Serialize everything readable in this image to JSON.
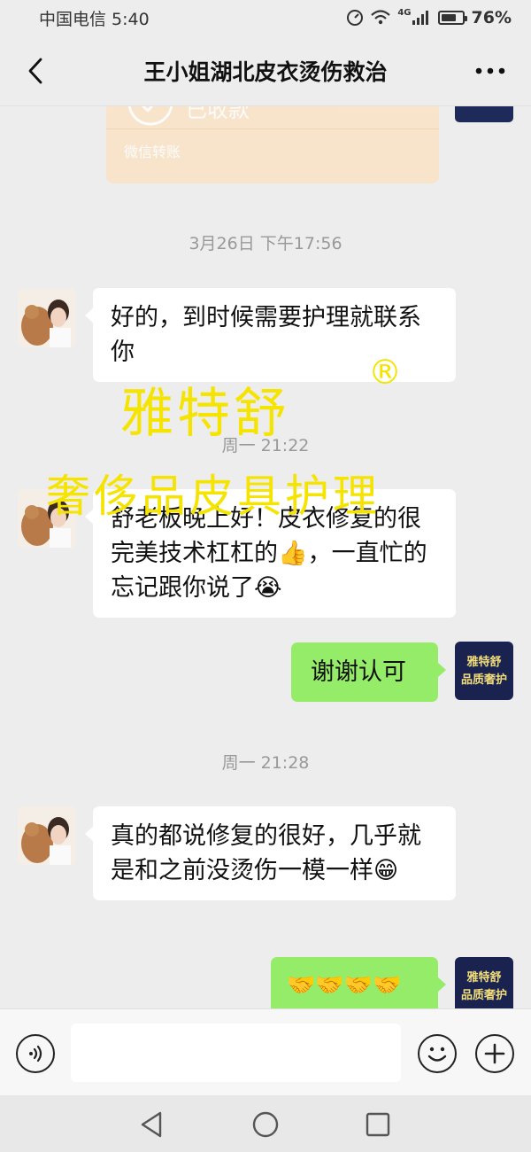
{
  "status_bar": {
    "carrier_time": "中国电信 5:40",
    "network": "4G",
    "battery": "76%",
    "battery_level": 0.76
  },
  "header": {
    "title": "王小姐湖北皮衣烫伤救治",
    "back_icon": "chevron-left-icon",
    "more_icon": "more-dots-icon"
  },
  "transfer": {
    "status": "已收款",
    "label": "微信转账"
  },
  "messages": [
    {
      "type": "timestamp",
      "text": "3月26日 下午17:56"
    },
    {
      "type": "received",
      "text": "好的，到时候需要护理就联系你"
    },
    {
      "type": "timestamp",
      "text": "周一 21:22"
    },
    {
      "type": "received",
      "text": "舒老板晚上好！皮衣修复的很完美技术杠杠的👍，一直忙的忘记跟你说了😭"
    },
    {
      "type": "sent",
      "text": "谢谢认可"
    },
    {
      "type": "timestamp",
      "text": "周一 21:28"
    },
    {
      "type": "received",
      "text": "真的都说修复的很好，几乎就是和之前没烫伤一模一样😁"
    },
    {
      "type": "sent",
      "text": "🤝🤝🤝🤝"
    }
  ],
  "brand_avatar": {
    "line1": "雅特舒",
    "line2": "品质奢护"
  },
  "watermark": {
    "line1": "雅特舒",
    "reg": "®",
    "line2": "奢侈品皮具护理"
  },
  "input_bar": {
    "value": "",
    "voice_icon": "voice-icon",
    "emoji_icon": "emoji-icon",
    "plus_icon": "plus-icon"
  },
  "colors": {
    "background": "#ededed",
    "sent_bubble": "#95ec69",
    "received_bubble": "#ffffff",
    "transfer_card": "#fbe3c6",
    "watermark": "#f5e300"
  }
}
